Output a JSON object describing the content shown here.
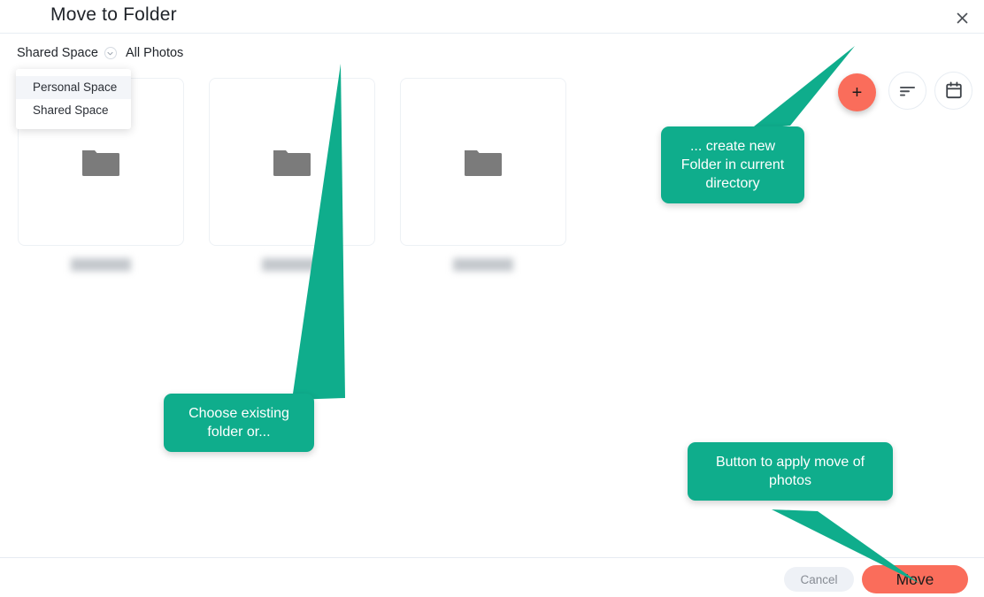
{
  "dialog": {
    "title": "Move to Folder",
    "close_icon": "close-icon"
  },
  "toolbar": {
    "space_selector": {
      "label": "Shared Space",
      "chevron_icon": "chevron-down-icon",
      "options": [
        "Personal Space",
        "Shared Space"
      ],
      "highlighted_option": "Personal Space"
    },
    "tab_all_photos": "All Photos",
    "add_button": {
      "label": "+",
      "icon": "plus-icon",
      "color": "#fa6d5b"
    },
    "sort_button": {
      "icon": "sort-icon"
    },
    "calendar_button": {
      "icon": "calendar-icon"
    }
  },
  "folders": [
    {
      "name": "",
      "icon": "folder-icon",
      "redacted": true
    },
    {
      "name": "",
      "icon": "folder-icon",
      "redacted": true
    },
    {
      "name": "",
      "icon": "folder-icon",
      "redacted": true
    }
  ],
  "callouts": [
    {
      "id": "create",
      "text": "... create new Folder in current directory",
      "color": "#0fad8c"
    },
    {
      "id": "choose",
      "text": "Choose existing folder or...",
      "color": "#0fad8c"
    },
    {
      "id": "move",
      "text": "Button to apply move of photos",
      "color": "#0fad8c"
    }
  ],
  "footer": {
    "cancel_label": "Cancel",
    "move_label": "Move",
    "move_color": "#fa6d5b",
    "cancel_color": "#eef1f6"
  }
}
